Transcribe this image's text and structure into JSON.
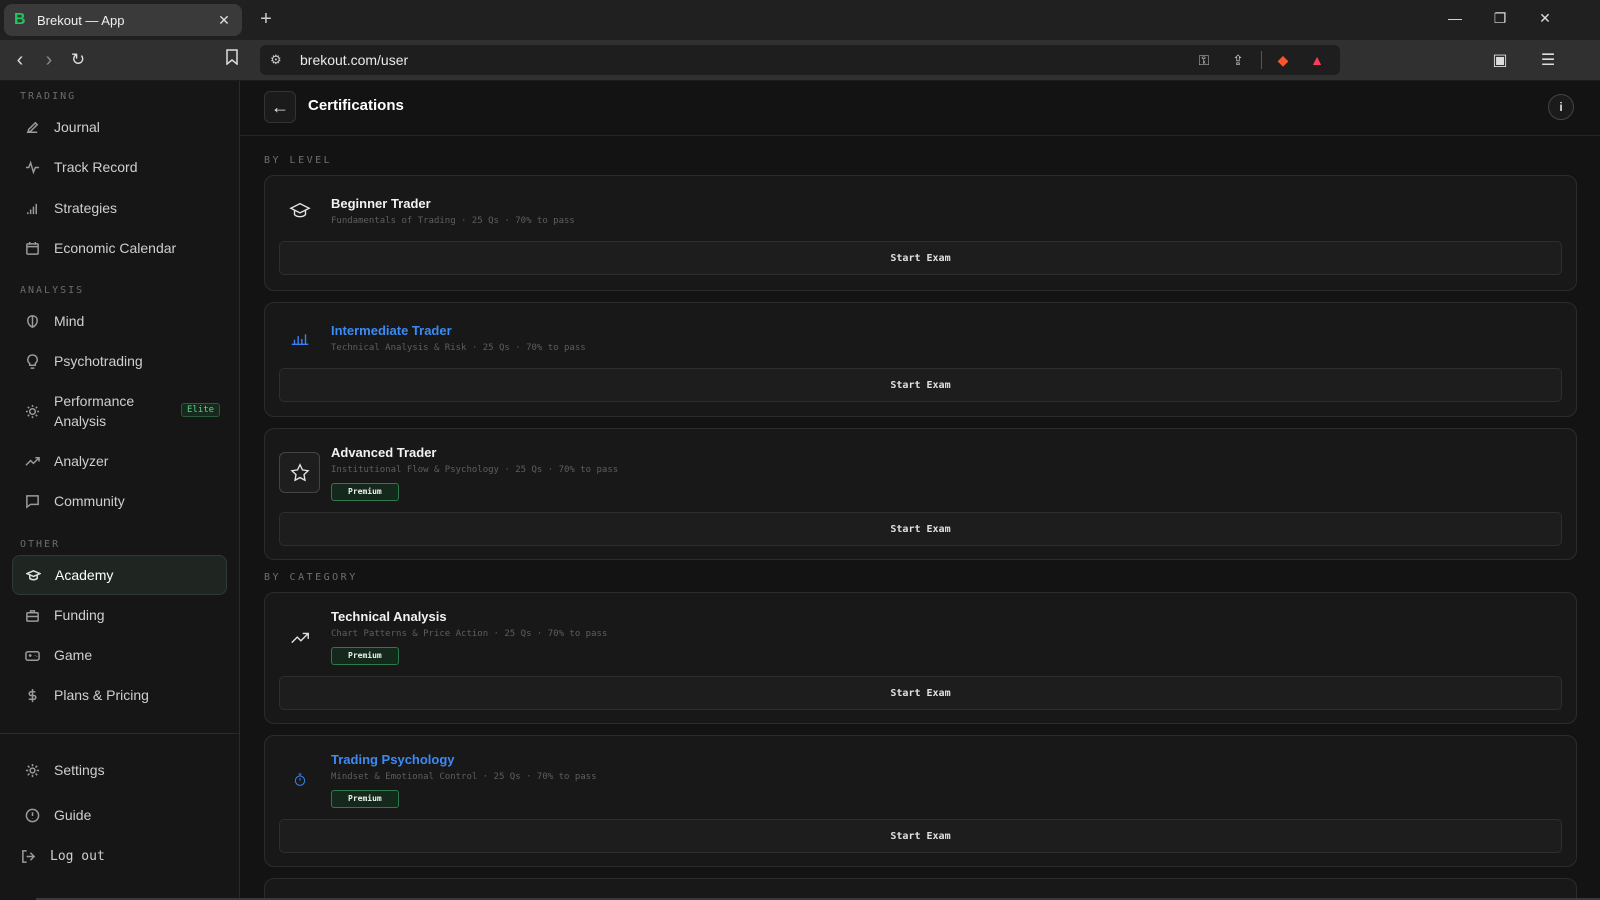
{
  "browser": {
    "tab_title": "Brekout — App",
    "tab_favicon": "B",
    "url": "brekout.com/user"
  },
  "sidebar": {
    "sections": {
      "trading": "TRADING",
      "analysis": "ANALYSIS",
      "other": "OTHER"
    },
    "items": {
      "journal": "Journal",
      "track_record": "Track Record",
      "strategies": "Strategies",
      "economic_calendar": "Economic Calendar",
      "mind": "Mind",
      "psychotrading": "Psychotrading",
      "performance_analysis": "Performance Analysis",
      "performance_badge": "Elite",
      "analyzer": "Analyzer",
      "community": "Community",
      "academy": "Academy",
      "funding": "Funding",
      "game": "Game",
      "plans_pricing": "Plans & Pricing",
      "settings": "Settings",
      "guide": "Guide",
      "logout": "Log out"
    }
  },
  "header": {
    "title": "Certifications",
    "back_icon": "arrow-left-icon",
    "info_icon": "info-icon"
  },
  "groups": {
    "by_level": "BY LEVEL",
    "by_category": "BY CATEGORY"
  },
  "certifications": [
    {
      "title": "Beginner Trader",
      "meta": "Fundamentals of Trading · 25 Qs · 70% to pass",
      "premium": false,
      "button": "Start Exam",
      "icon": "graduation-cap-icon"
    },
    {
      "title": "Intermediate Trader",
      "meta": "Technical Analysis & Risk · 25 Qs · 70% to pass",
      "premium": false,
      "button": "Start Exam",
      "icon": "bar-chart-icon"
    },
    {
      "title": "Advanced Trader",
      "meta": "Institutional Flow & Psychology · 25 Qs · 70% to pass",
      "premium": true,
      "badge": "Premium",
      "button": "Start Exam",
      "icon": "star-icon"
    },
    {
      "title": "Technical Analysis",
      "meta": "Chart Patterns & Price Action · 25 Qs · 70% to pass",
      "premium": true,
      "badge": "Premium",
      "button": "Start Exam",
      "icon": "trending-up-icon"
    },
    {
      "title": "Trading Psychology",
      "meta": "Mindset & Emotional Control · 25 Qs · 70% to pass",
      "premium": true,
      "badge": "Premium",
      "button": "Start Exam",
      "icon": "stopwatch-icon"
    }
  ],
  "colors": {
    "accent_blue": "#3b8bf6",
    "premium_green": "#2a7a4a",
    "background": "#131313"
  }
}
